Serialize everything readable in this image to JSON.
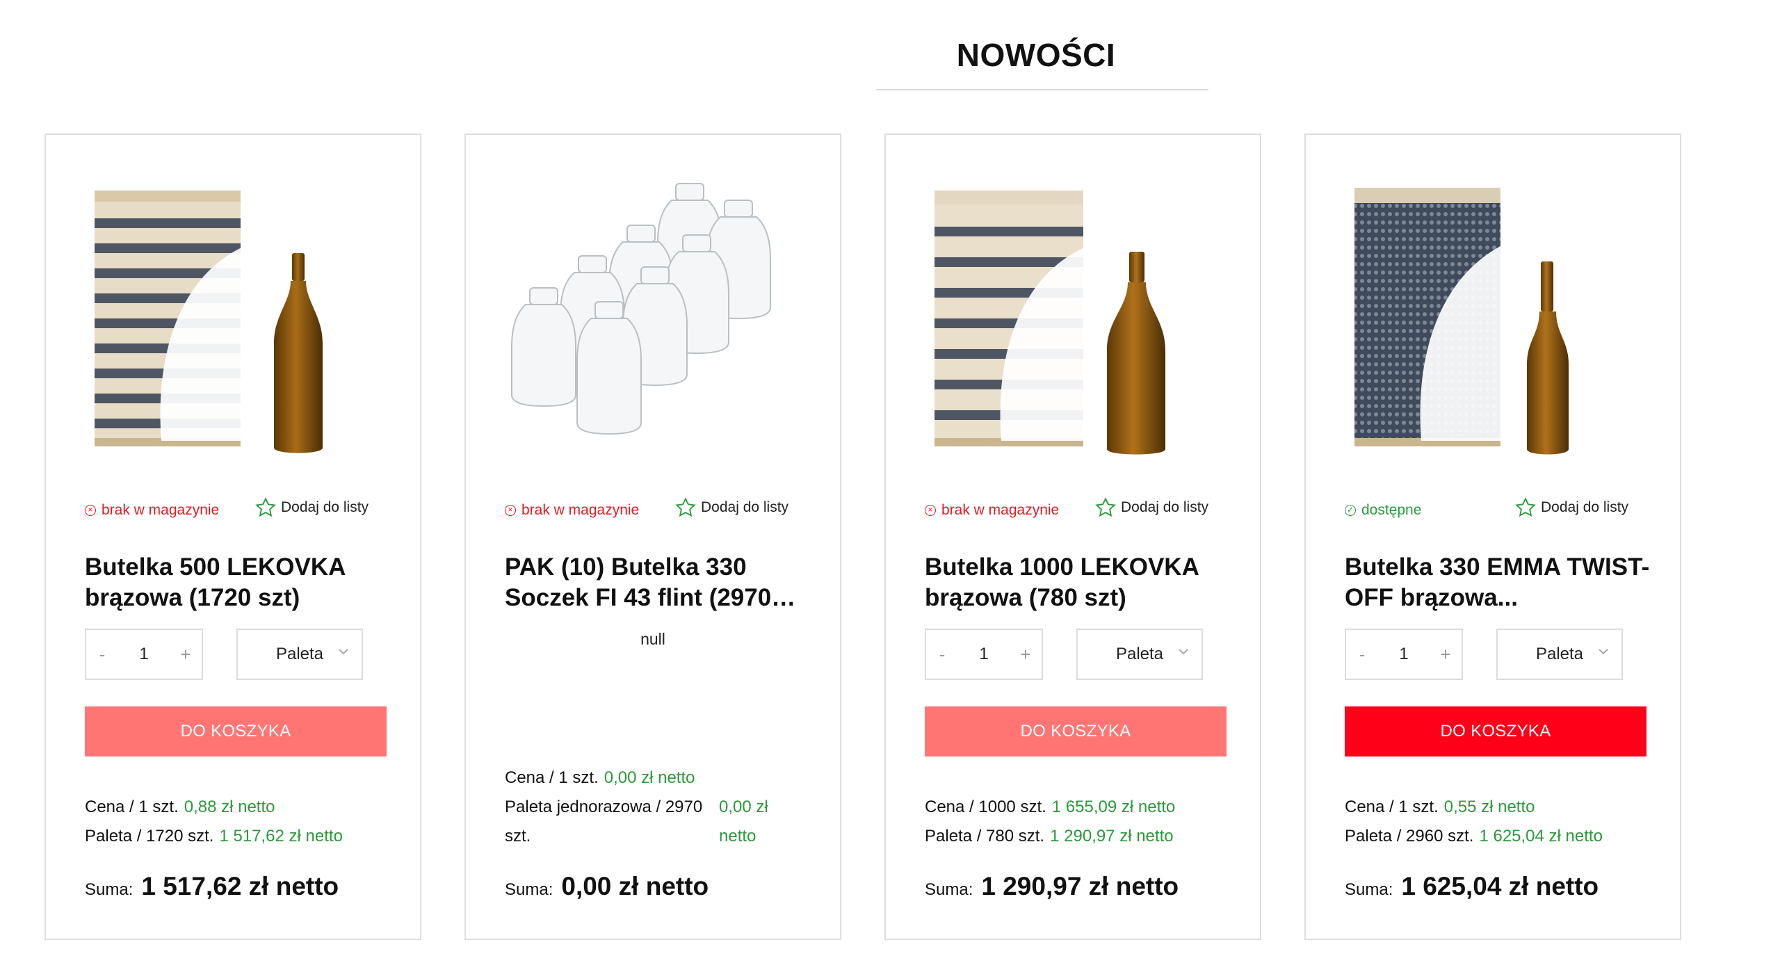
{
  "section": {
    "title": "NOWOŚCI"
  },
  "common": {
    "wish_label": "Dodaj do listy",
    "cart_label": "DO KOSZYKA",
    "sum_label": "Suma:",
    "minus": "-",
    "plus": "+"
  },
  "products": [
    {
      "status": "brak w magazynie",
      "name": "Butelka 500 LEKOVKA brązowa (1720 szt)",
      "qty": "1",
      "unit": "Paleta",
      "price1_label": "Cena / 1 szt.",
      "price1_value": "0,88 zł netto",
      "price2_label": "Paleta / 1720 szt.",
      "price2_value": "1 517,62 zł netto",
      "sum": "1 517,62 zł netto"
    },
    {
      "status": "brak w magazynie",
      "name": "PAK (10) Butelka 330 Soczek FI 43 flint (2970…",
      "null_text": "null",
      "price1_label": "Cena / 1 szt.",
      "price1_value": "0,00 zł netto",
      "price2_label": "Paleta jednorazowa / 2970 szt.",
      "price2_value": "0,00 zł netto",
      "sum": "0,00 zł netto"
    },
    {
      "status": "brak w magazynie",
      "name": "Butelka 1000 LEKOVKA brązowa (780 szt)",
      "qty": "1",
      "unit": "Paleta",
      "price1_label": "Cena / 1000 szt.",
      "price1_value": "1 655,09 zł netto",
      "price2_label": "Paleta / 780 szt.",
      "price2_value": "1 290,97 zł netto",
      "sum": "1 290,97 zł netto"
    },
    {
      "status": "dostępne",
      "name": "Butelka 330 EMMA TWIST-OFF brązowa...",
      "qty": "1",
      "unit": "Paleta",
      "price1_label": "Cena / 1 szt.",
      "price1_value": "0,55 zł netto",
      "price2_label": "Paleta / 2960 szt.",
      "price2_value": "1 625,04 zł netto",
      "sum": "1 625,04 zł netto"
    }
  ],
  "colors": {
    "out_of_stock": "#e21a22",
    "available": "#2a9a3a",
    "cart_dim": "#ff7574",
    "cart_active": "#ff0019"
  }
}
